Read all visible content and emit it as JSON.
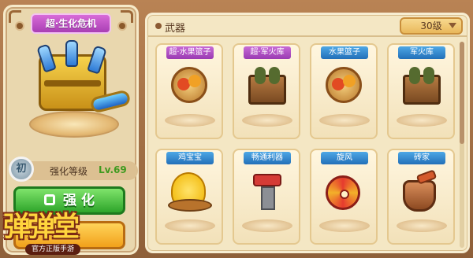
{
  "left_panel": {
    "item_title": "超·生化危机",
    "badge_text": "初",
    "level_label": "强化等级",
    "level_value": "Lv.69",
    "enhance_button_label": "强 化"
  },
  "logo": {
    "title": "弹弹堂",
    "subtitle": "官方正版手游"
  },
  "right_panel": {
    "tab_title": "武器",
    "level_filter": "30级"
  },
  "weapons": [
    {
      "name": "超·水果篮子",
      "label_color": "purple",
      "icon": "fruit-basket-icon"
    },
    {
      "name": "超·军火库",
      "label_color": "purple",
      "icon": "arsenal-crate-icon"
    },
    {
      "name": "水果篮子",
      "label_color": "blue",
      "icon": "fruit-basket-icon"
    },
    {
      "name": "军火库",
      "label_color": "blue",
      "icon": "arsenal-crate-icon"
    },
    {
      "name": "鸡宝宝",
      "label_color": "blue",
      "icon": "chick-icon"
    },
    {
      "name": "畅通利器",
      "label_color": "blue",
      "icon": "plunger-hammer-icon"
    },
    {
      "name": "旋风",
      "label_color": "blue",
      "icon": "shuriken-icon"
    },
    {
      "name": "砖家",
      "label_color": "blue",
      "icon": "brick-pot-icon"
    }
  ],
  "colors": {
    "purple_label": "#a64bbd",
    "blue_label": "#2f86cc",
    "enhance_green": "#2da52a",
    "level_green": "#3f9a1f"
  }
}
